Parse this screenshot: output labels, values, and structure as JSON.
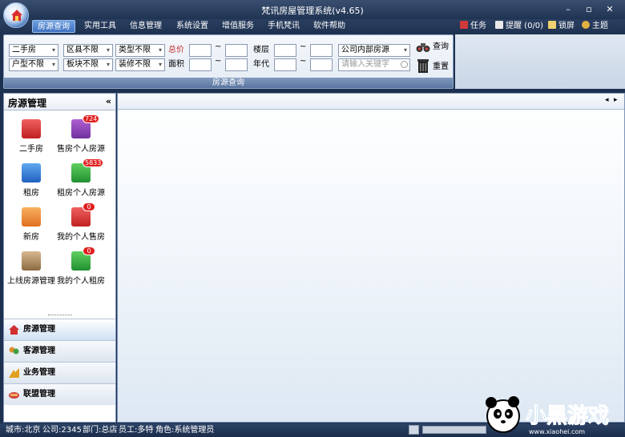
{
  "app": {
    "title": "梵讯房屋管理系统(v4.65)"
  },
  "window_controls": {
    "minimize": "–",
    "maximize": "▫",
    "close": "✕"
  },
  "menu": [
    "房源查询",
    "实用工具",
    "信息管理",
    "系统设置",
    "增值服务",
    "手机梵讯",
    "软件帮助"
  ],
  "right_menu": {
    "task": "任务",
    "reminder": "提醒 (0/0)",
    "lock": "锁屏",
    "theme": "主题"
  },
  "filters": {
    "row1": [
      "二手房",
      "区县不限",
      "类型不限"
    ],
    "row2": [
      "户型不限",
      "板块不限",
      "装修不限"
    ],
    "total_price_label": "总价",
    "area_label": "面积",
    "floor_label": "楼层",
    "year_label": "年代",
    "tilde": "~",
    "source_select": "公司内部房源",
    "search_placeholder": "请输入关键字",
    "query_button": "查询",
    "reset_button": "重置",
    "panel_caption": "房源查询"
  },
  "sidebar": {
    "title": "房源管理",
    "collapse": "«",
    "items": [
      {
        "label": "二手房",
        "badge": ""
      },
      {
        "label": "售房个人房源",
        "badge": "724"
      },
      {
        "label": "租房",
        "badge": ""
      },
      {
        "label": "租房个人房源",
        "badge": "5833"
      },
      {
        "label": "新房",
        "badge": ""
      },
      {
        "label": "我的个人售房",
        "badge": "0"
      },
      {
        "label": "上线房源管理",
        "badge": ""
      },
      {
        "label": "我的个人租房",
        "badge": "0"
      }
    ],
    "accordion": [
      "房源管理",
      "客源管理",
      "业务管理",
      "联盟管理"
    ]
  },
  "tabs_nav": {
    "prev": "◂",
    "next": "▸"
  },
  "status": {
    "city": "城市:北京",
    "company": "公司:2345",
    "dept": "部门:总店",
    "staff": "员工:多特",
    "role": "角色:系统管理员"
  },
  "watermark": {
    "text": "小黑游戏",
    "url": "www.xiaohei.com"
  },
  "colors": {
    "accent": "#3f72c0",
    "titlebar": "#1f3352",
    "badge": "#e02020"
  }
}
